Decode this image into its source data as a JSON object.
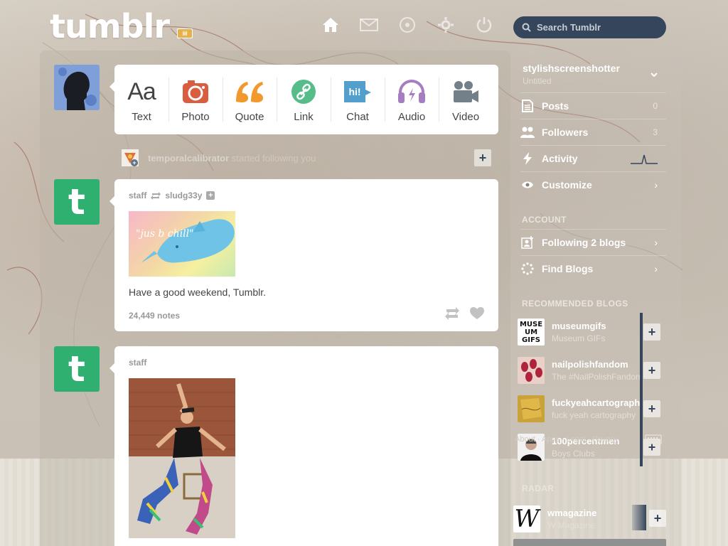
{
  "header": {
    "logo": "tumblr",
    "search_placeholder": "Search Tumblr"
  },
  "post_types": [
    {
      "label": "Text",
      "icon": "text-aa-icon"
    },
    {
      "label": "Photo",
      "icon": "camera-icon"
    },
    {
      "label": "Quote",
      "icon": "quote-icon"
    },
    {
      "label": "Link",
      "icon": "link-icon"
    },
    {
      "label": "Chat",
      "icon": "chat-bubble-icon"
    },
    {
      "label": "Audio",
      "icon": "headphones-icon"
    },
    {
      "label": "Video",
      "icon": "video-camera-icon"
    }
  ],
  "activity": {
    "user": "temporalcalibrator",
    "text": "started following you"
  },
  "posts": [
    {
      "author": "staff",
      "reblogged_from": "sludg33y",
      "image_text": "\"jus b chill\"",
      "caption": "Have a good weekend, Tumblr.",
      "notes": "24,449 notes"
    },
    {
      "author": "staff"
    }
  ],
  "sidebar": {
    "blog_name": "stylishscreenshotter",
    "blog_title": "Untitled",
    "items": [
      {
        "label": "Posts",
        "count": "0"
      },
      {
        "label": "Followers",
        "count": "3"
      },
      {
        "label": "Activity"
      },
      {
        "label": "Customize"
      }
    ],
    "account_title": "ACCOUNT",
    "account_items": [
      {
        "label": "Following 2 blogs"
      },
      {
        "label": "Find Blogs"
      }
    ],
    "recommended_title": "RECOMMENDED BLOGS",
    "recommended": [
      {
        "name": "museumgifs",
        "title": "Museum GIFs",
        "thumb_text": "MUSEUM GIFS"
      },
      {
        "name": "nailpolishfandom",
        "title": "The #NailPolishFandom"
      },
      {
        "name": "fuckyeahcartography",
        "title": "fuck yeah cartography"
      },
      {
        "name": "100percentmen",
        "title": "Boys Clubs"
      }
    ],
    "footer": "About · Apps · Legal · Privacy",
    "radar_title": "RADAR",
    "radar": {
      "name": "wmagazine",
      "title": "W Magazine",
      "thumb_text": "W"
    }
  },
  "colors": {
    "navy": "#35465c",
    "tumblr_green": "#2fb071",
    "text_icon": "#444444",
    "photo_icon": "#d95e40",
    "quote_icon": "#f2992e",
    "link_icon": "#56bc8a",
    "chat_icon": "#529ecc",
    "audio_icon": "#a77dc2",
    "video_icon": "#748089"
  }
}
